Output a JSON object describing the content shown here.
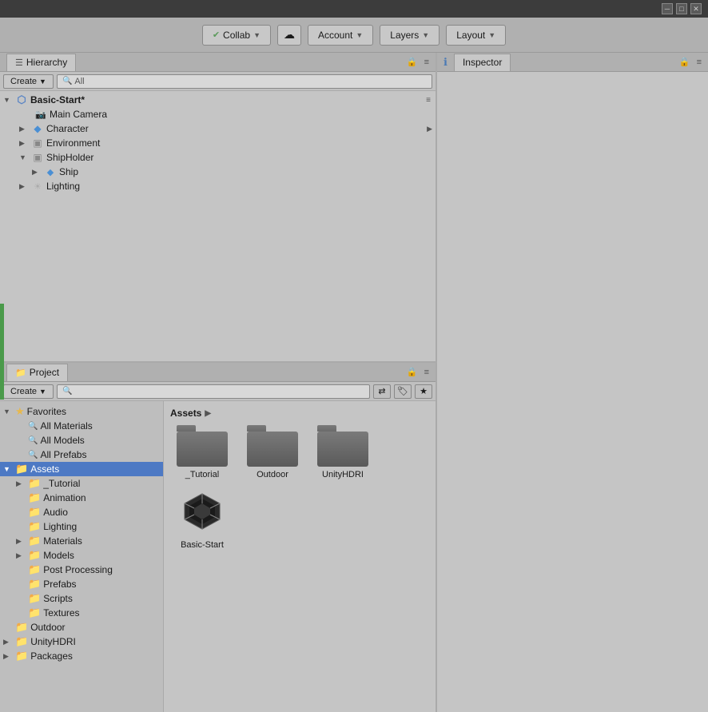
{
  "titlebar": {
    "minimize_label": "─",
    "maximize_label": "□",
    "close_label": "✕"
  },
  "menubar": {
    "collab_label": "Collab",
    "account_label": "Account",
    "layers_label": "Layers",
    "layout_label": "Layout"
  },
  "hierarchy": {
    "panel_label": "Hierarchy",
    "create_label": "Create",
    "search_placeholder": "All",
    "scene": {
      "name": "Basic-Start*",
      "children": [
        {
          "id": "main-camera",
          "label": "Main Camera",
          "icon": "camera",
          "indent": 1,
          "arrow": "leaf"
        },
        {
          "id": "character",
          "label": "Character",
          "icon": "char",
          "indent": 1,
          "arrow": "closed",
          "has_right_arrow": true
        },
        {
          "id": "environment",
          "label": "Environment",
          "icon": "folder",
          "indent": 1,
          "arrow": "closed"
        },
        {
          "id": "shipholder",
          "label": "ShipHolder",
          "icon": "folder",
          "indent": 1,
          "arrow": "open"
        },
        {
          "id": "ship",
          "label": "Ship",
          "icon": "ship",
          "indent": 2,
          "arrow": "closed"
        },
        {
          "id": "lighting",
          "label": "Lighting",
          "icon": "light",
          "indent": 1,
          "arrow": "closed"
        }
      ]
    }
  },
  "project": {
    "panel_label": "Project",
    "create_label": "Create",
    "search_placeholder": "",
    "sidebar": {
      "favorites": {
        "label": "Favorites",
        "items": [
          {
            "id": "all-materials",
            "label": "All Materials"
          },
          {
            "id": "all-models",
            "label": "All Models"
          },
          {
            "id": "all-prefabs",
            "label": "All Prefabs"
          }
        ]
      },
      "assets": {
        "label": "Assets",
        "items": [
          {
            "id": "tutorial",
            "label": "_Tutorial"
          },
          {
            "id": "animation",
            "label": "Animation"
          },
          {
            "id": "audio",
            "label": "Audio"
          },
          {
            "id": "lighting",
            "label": "Lighting"
          },
          {
            "id": "materials",
            "label": "Materials"
          },
          {
            "id": "models",
            "label": "Models"
          },
          {
            "id": "post-processing",
            "label": "Post Processing"
          },
          {
            "id": "prefabs",
            "label": "Prefabs"
          },
          {
            "id": "scripts",
            "label": "Scripts"
          },
          {
            "id": "textures",
            "label": "Textures"
          }
        ]
      },
      "outdoor": {
        "label": "Outdoor"
      },
      "unity-hdri": {
        "label": "UnityHDRI"
      },
      "packages": {
        "label": "Packages"
      }
    },
    "assets_content": {
      "breadcrumb": "Assets",
      "folders": [
        {
          "id": "tutorial-folder",
          "label": "_Tutorial"
        },
        {
          "id": "outdoor-folder",
          "label": "Outdoor"
        },
        {
          "id": "unityhdri-folder",
          "label": "UnityHDRI"
        }
      ],
      "unity_assets": [
        {
          "id": "basic-start-asset",
          "label": "Basic-Start"
        }
      ]
    }
  },
  "inspector": {
    "panel_label": "Inspector",
    "info_icon": "ℹ"
  }
}
